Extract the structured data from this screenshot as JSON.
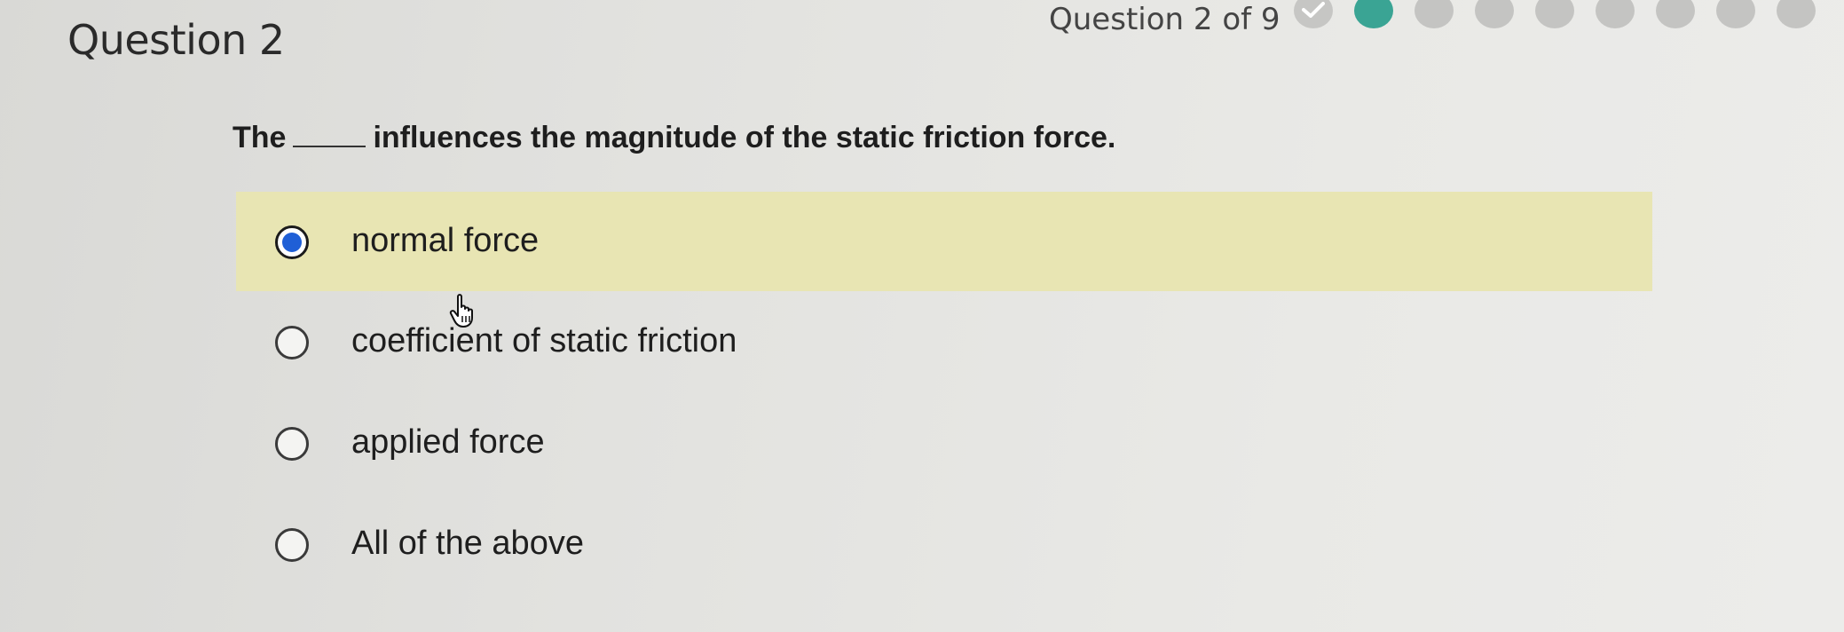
{
  "header": {
    "title": "Question 2",
    "progress_label": "Question 2 of 9"
  },
  "progress": {
    "current": 2,
    "total": 9,
    "completed": [
      1
    ]
  },
  "question": {
    "prefix": "The",
    "suffix": "influences the magnitude of the static friction force."
  },
  "options": [
    {
      "label": "normal force",
      "selected": true
    },
    {
      "label": "coefficient of static friction",
      "selected": false
    },
    {
      "label": "applied force",
      "selected": false
    },
    {
      "label": "All of the above",
      "selected": false
    }
  ],
  "icons": {
    "completed_dot": "check-icon",
    "cursor": "hand-pointer-icon"
  },
  "colors": {
    "selected_highlight": "#e8e5b3",
    "radio_checked": "#1f5fd6",
    "current_dot": "#3aa494",
    "pending_dot": "#c4c4c2"
  }
}
